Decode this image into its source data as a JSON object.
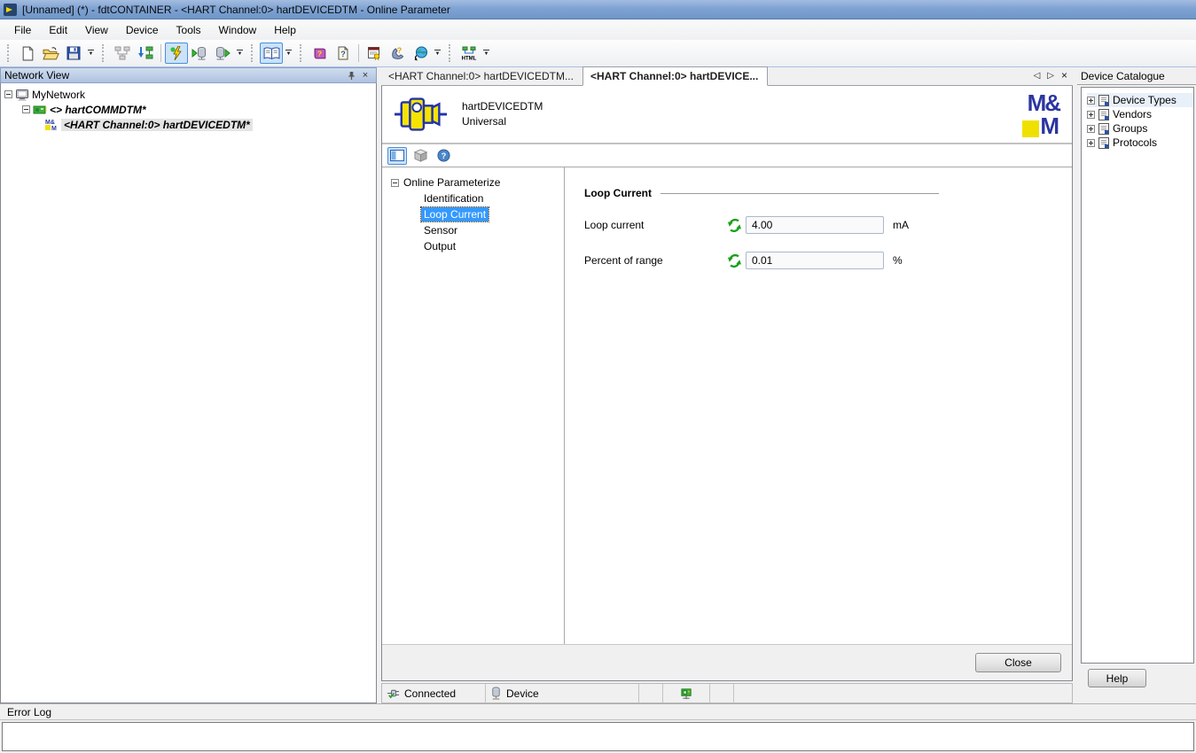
{
  "title_bar": {
    "title": "[Unnamed] (*)  - fdtCONTAINER - <HART Channel:0> hartDEVICEDTM - Online Parameter"
  },
  "menu": {
    "items": [
      "File",
      "Edit",
      "View",
      "Device",
      "Tools",
      "Window",
      "Help"
    ]
  },
  "toolbar": {
    "buttons": [
      "new-project",
      "open-project",
      "save-project",
      "save-dropdown",
      "network-topology",
      "add-device",
      "connect",
      "upload-from-device",
      "download-to-device",
      "device-actions-dropdown",
      "device-catalogue-toggle",
      "catalogue-dropdown",
      "help-contents",
      "help-topic",
      "license-info",
      "support",
      "web-link",
      "help-dropdown",
      "html-export",
      "export-dropdown"
    ],
    "pressed": [
      "connect",
      "device-catalogue-toggle"
    ]
  },
  "icons": {
    "dropdown": "▼",
    "close": "×",
    "tab_prev": "◁",
    "tab_next": "▷"
  },
  "network_view": {
    "title": "Network View",
    "tree": [
      {
        "label": "MyNetwork"
      },
      {
        "label": "<> hartCOMMDTM*"
      },
      {
        "label": "<HART Channel:0> hartDEVICEDTM*"
      }
    ]
  },
  "tabs": [
    {
      "label": "<HART Channel:0> hartDEVICEDTM..."
    },
    {
      "label": "<HART Channel:0> hartDEVICE..."
    }
  ],
  "dtm": {
    "device_name": "hartDEVICEDTM",
    "device_type": "Universal",
    "logo": {
      "top": "M&",
      "bottom": "M"
    },
    "nav": {
      "root": "Online Parameterize",
      "items": [
        "Identification",
        "Loop Current",
        "Sensor",
        "Output"
      ],
      "selected": "Loop Current"
    },
    "section_title": "Loop Current",
    "fields": [
      {
        "label": "Loop current",
        "value": "4.00",
        "unit": "mA"
      },
      {
        "label": "Percent of range",
        "value": "0.01",
        "unit": "%"
      }
    ],
    "close_label": "Close",
    "status": {
      "connected": "Connected",
      "device": "Device"
    }
  },
  "device_catalogue": {
    "title": "Device Catalogue",
    "items": [
      "Device Types",
      "Vendors",
      "Groups",
      "Protocols"
    ],
    "help_label": "Help"
  },
  "error_log": {
    "title": "Error Log"
  },
  "colors": {
    "selection": "#3399ff",
    "logo_blue": "#2b35a0",
    "logo_yellow": "#f0e000",
    "titlebar": "#7fa3d3",
    "sync_green": "#18a018"
  }
}
